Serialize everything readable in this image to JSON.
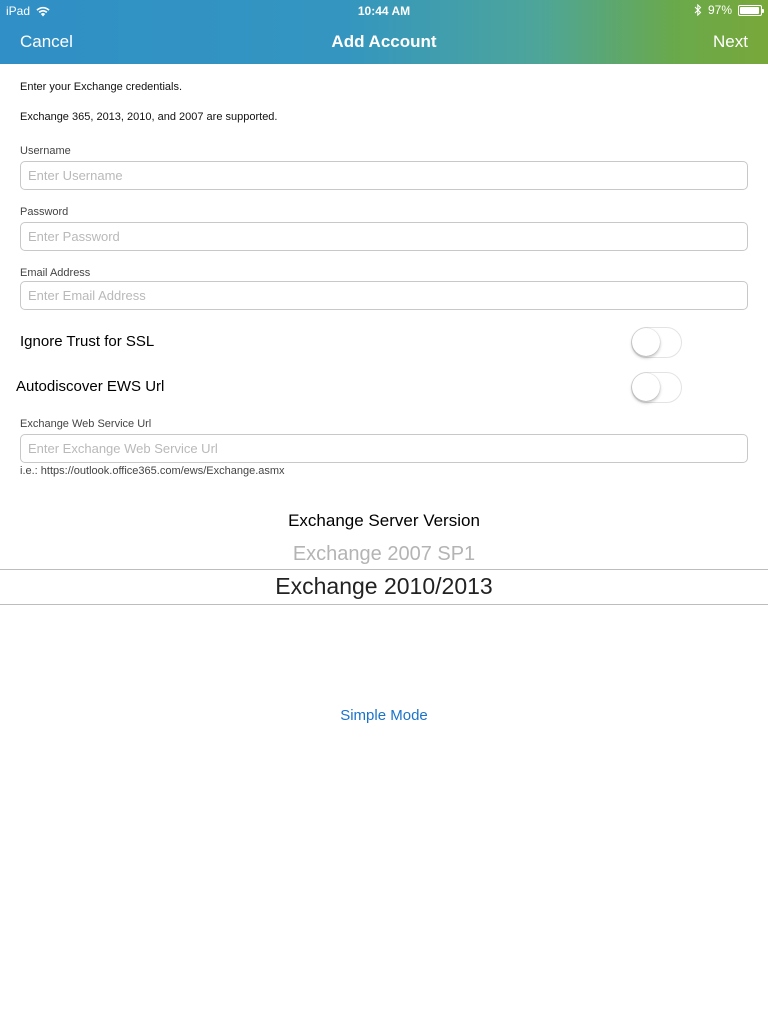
{
  "status_bar": {
    "device": "iPad",
    "time": "10:44 AM",
    "battery": "97%",
    "battery_level": 0.97
  },
  "nav": {
    "cancel_label": "Cancel",
    "title": "Add Account",
    "next_label": "Next"
  },
  "info": {
    "line1": "Enter your Exchange credentials.",
    "line2": "Exchange 365, 2013, 2010, and 2007 are supported."
  },
  "fields": {
    "username": {
      "label": "Username",
      "value": "",
      "placeholder": "Enter Username"
    },
    "password": {
      "label": "Password",
      "value": "",
      "placeholder": "Enter Password"
    },
    "email": {
      "label": "Email Address",
      "value": "",
      "placeholder": "Enter Email Address"
    },
    "ews_url": {
      "label": "Exchange Web Service Url",
      "value": "",
      "placeholder": "Enter Exchange Web Service Url"
    }
  },
  "toggles": {
    "ignore_trust": {
      "label": "Ignore Trust for SSL",
      "on": false
    },
    "autodiscover": {
      "label": "Autodiscover EWS Url",
      "on": false
    }
  },
  "ews_hint": "i.e.: https://outlook.office365.com/ews/Exchange.asmx",
  "picker": {
    "title": "Exchange Server Version",
    "options": [
      "Exchange 2007 SP1",
      "Exchange 2010/2013"
    ],
    "selected": "Exchange 2010/2013"
  },
  "simple_mode_label": "Simple Mode",
  "colors": {
    "header_gradient_start": "#2f8fc6",
    "header_gradient_end": "#78a83a",
    "link": "#1a73c9"
  }
}
